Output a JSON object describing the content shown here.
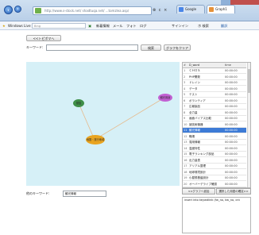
{
  "browser": {
    "address": "http://www.s-stock.net/ shadtuqa.net/ ...tomzlea.asp/",
    "address_buttons": "⊗ c ×",
    "tabs": [
      {
        "label": "Google",
        "color": "#4a86e8"
      },
      {
        "label": "Graph1",
        "color": "#e69138"
      }
    ]
  },
  "toolbar": {
    "favorite": "Windows Live",
    "search_placeholder": "Bing",
    "menu": [
      "新着情報",
      "メール",
      "フォト",
      "ログ"
    ],
    "signin": "サインイン",
    "right_items": [
      "ホ 検索",
      "翻訳"
    ]
  },
  "page": {
    "back_label": "<<トピボマへ",
    "keyword_label": "キーワード:",
    "keyword_value": "",
    "search_label": "検索",
    "clear_label": "グラフをクリア"
  },
  "graph": {
    "colors": {
      "canvas": "#d6f0f7",
      "edge": "#e6b98a"
    },
    "nodes": [
      {
        "id": "n1",
        "label": "基盤",
        "color": "#3f8f48"
      },
      {
        "id": "n2",
        "label": "観光用途",
        "color": "#c15fd2"
      },
      {
        "id": "n3",
        "label": "地図・旅行地域",
        "color": "#e9a420"
      }
    ],
    "edges": [
      [
        "n1",
        "n3"
      ],
      [
        "n2",
        "n3"
      ]
    ]
  },
  "table": {
    "headers": [
      "#",
      "D_word",
      "time"
    ],
    "selected_index": 10,
    "rows": [
      {
        "n": "1",
        "word": "ＣＨＯＳ",
        "time": "00:00:00"
      },
      {
        "n": "2",
        "word": "PHP開発",
        "time": "00:00:00"
      },
      {
        "n": "3",
        "word": "ドレイン",
        "time": "00:00:00"
      },
      {
        "n": "4",
        "word": "データ",
        "time": "00:00:00"
      },
      {
        "n": "5",
        "word": "テスト",
        "time": "00:00:00"
      },
      {
        "n": "6",
        "word": "ボランティア",
        "time": "00:00:00"
      },
      {
        "n": "7",
        "word": "広報製品",
        "time": "00:00:00"
      },
      {
        "n": "8",
        "word": "全力量",
        "time": "00:00:00"
      },
      {
        "n": "9",
        "word": "画面バイアス比較",
        "time": "00:00:00"
      },
      {
        "n": "10",
        "word": "諸技術機器",
        "time": "00:00:00"
      },
      {
        "n": "11",
        "word": "観光情報",
        "time": "00:00:00"
      },
      {
        "n": "12",
        "word": "職場",
        "time": "00:00:00"
      },
      {
        "n": "13",
        "word": "運用情報",
        "time": "00:00:00"
      },
      {
        "n": "14",
        "word": "温度特性",
        "time": "00:00:00"
      },
      {
        "n": "15",
        "word": "電子ランキング部品",
        "time": "00:00:00"
      },
      {
        "n": "16",
        "word": "出力量表",
        "time": "00:00:00"
      },
      {
        "n": "17",
        "word": "アリアル整理",
        "time": "00:00:00"
      },
      {
        "n": "18",
        "word": "地球環境設計",
        "time": "00:00:00"
      },
      {
        "n": "19",
        "word": "小屋根基盤設計",
        "time": "00:00:00"
      },
      {
        "n": "20",
        "word": "オーバーデライブ確認",
        "time": "00:00:00"
      }
    ],
    "add_label": "<<グラフへ追加",
    "delete_label": "選択した用語の確定>>"
  },
  "bottom": {
    "current_label": "他のキーワード:",
    "current_value": "観光情報",
    "sql_text": "insert into keywdlink (fw_no, kw_no, cnt"
  }
}
